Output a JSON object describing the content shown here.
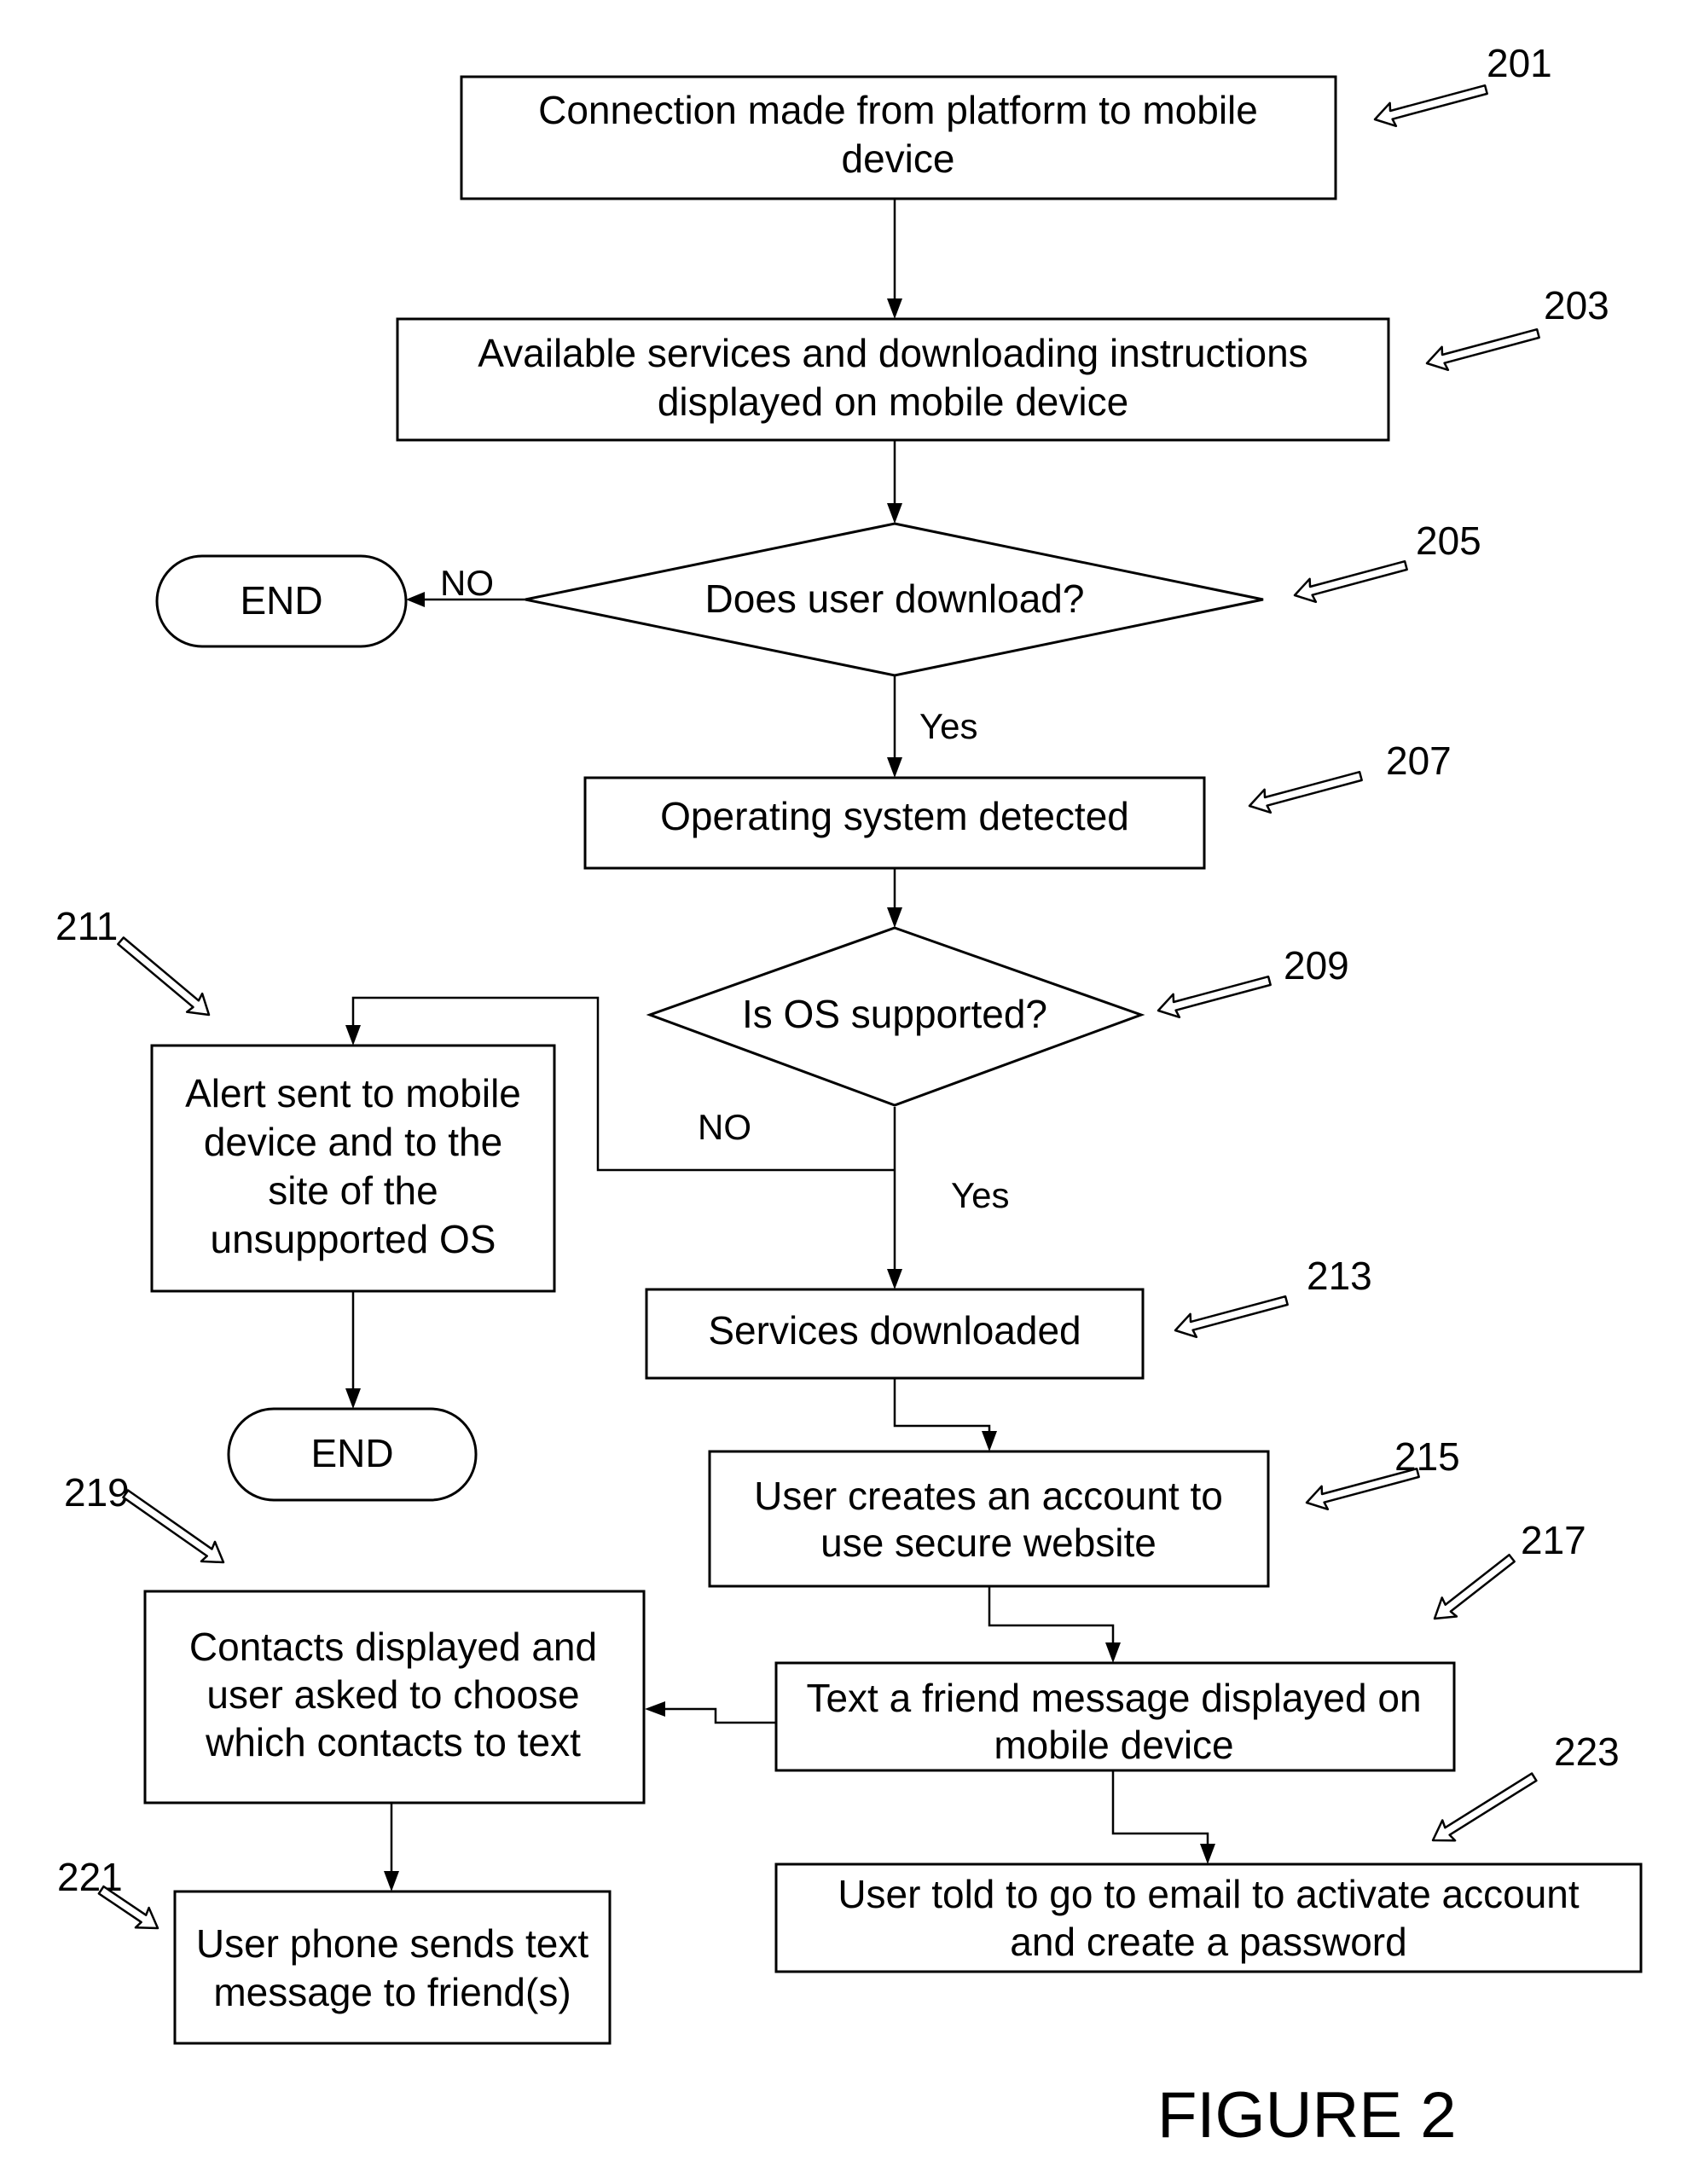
{
  "figure_label": "FIGURE 2",
  "steps": {
    "s201": {
      "ref": "201",
      "lines": [
        "Connection made from platform to mobile",
        "device"
      ]
    },
    "s203": {
      "ref": "203",
      "lines": [
        "Available services and downloading instructions",
        "displayed on mobile device"
      ]
    },
    "s205": {
      "ref": "205",
      "lines": [
        "Does user download?"
      ]
    },
    "s207": {
      "ref": "207",
      "lines": [
        "Operating system detected"
      ]
    },
    "s209": {
      "ref": "209",
      "lines": [
        "Is OS supported?"
      ]
    },
    "s211": {
      "ref": "211",
      "lines": [
        "Alert sent to mobile",
        "device and to the",
        "site of the",
        "unsupported OS"
      ]
    },
    "s213": {
      "ref": "213",
      "lines": [
        "Services downloaded"
      ]
    },
    "s215": {
      "ref": "215",
      "lines": [
        "User creates an account to",
        "use secure website"
      ]
    },
    "s217": {
      "ref": "217",
      "lines": [
        "Text a friend message displayed on",
        "mobile device"
      ]
    },
    "s219": {
      "ref": "219",
      "lines": [
        "Contacts displayed and",
        "user asked to choose",
        "which contacts to text"
      ]
    },
    "s221": {
      "ref": "221",
      "lines": [
        "User phone sends text",
        "message to friend(s)"
      ]
    },
    "s223": {
      "ref": "223",
      "lines": [
        "User told to go to email to activate account",
        "and create a password"
      ]
    }
  },
  "terminals": {
    "end1": "END",
    "end2": "END"
  },
  "branches": {
    "d205_no": "NO",
    "d205_yes": "Yes",
    "d209_no": "NO",
    "d209_yes": "Yes"
  }
}
